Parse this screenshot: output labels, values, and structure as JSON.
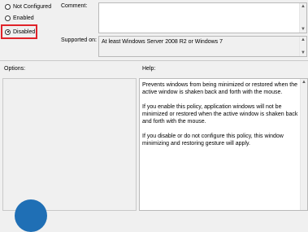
{
  "state": {
    "options": [
      "Not Configured",
      "Enabled",
      "Disabled"
    ],
    "selected": "Disabled"
  },
  "labels": {
    "comment": "Comment:",
    "supported_on": "Supported on:",
    "options": "Options:",
    "help": "Help:"
  },
  "supported_on_value": "At least Windows Server 2008 R2 or Windows 7",
  "help_paragraphs": [
    "Prevents windows from being minimized or restored when the active window is shaken back and forth with the mouse.",
    "If you enable this policy, application windows will not be minimized or restored when the active window is shaken back and forth with the mouse.",
    "If you disable or do not configure this policy, this window minimizing and restoring gesture will apply."
  ],
  "colors": {
    "highlight_border": "#e0232a",
    "overlay_circle": "#1f6fb5"
  }
}
